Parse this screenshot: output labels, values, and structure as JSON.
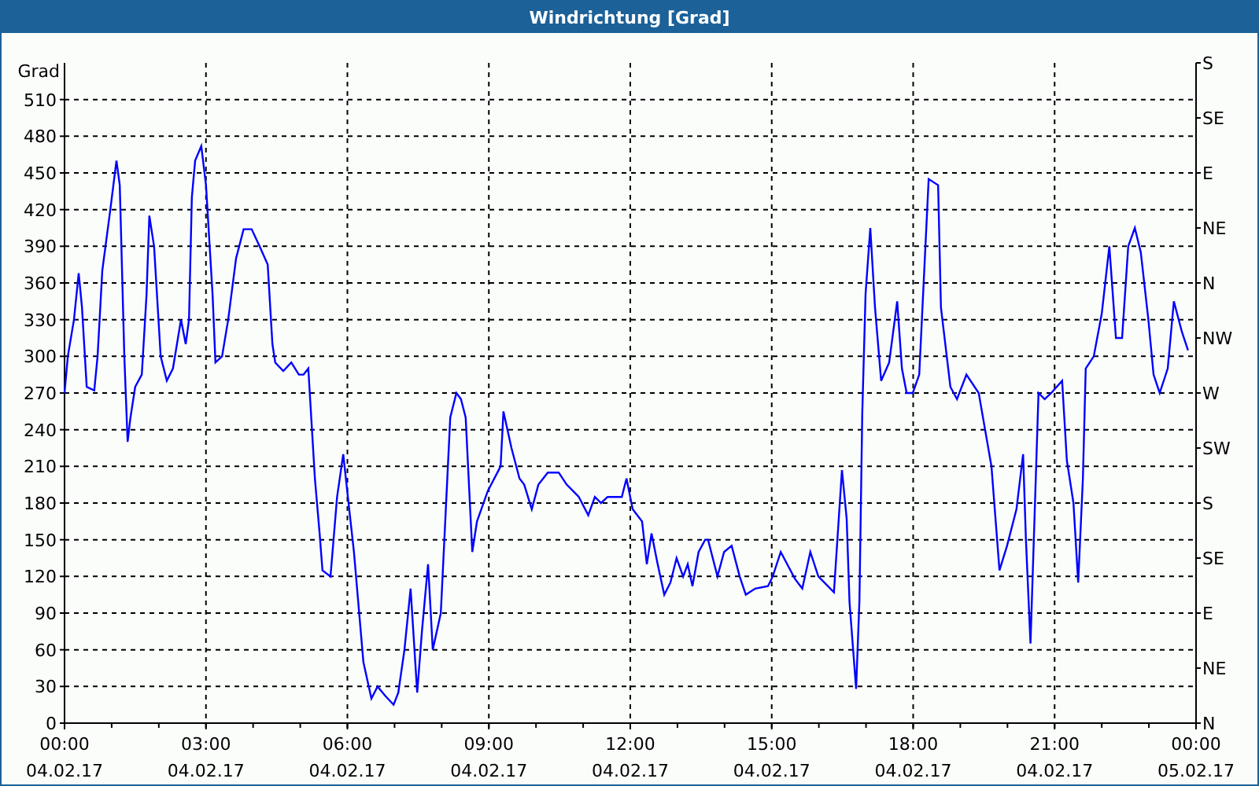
{
  "window": {
    "title": "Windrichtung [Grad]"
  },
  "chart": {
    "x_axis_dates": [
      "04.02.17",
      "04.02.17",
      "04.02.17",
      "04.02.17",
      "04.02.17",
      "04.02.17",
      "04.02.17",
      "04.02.17",
      "05.02.17"
    ],
    "right_axis": {
      "labels": [
        "S",
        "SE",
        "E",
        "NE",
        "N",
        "NW",
        "W",
        "SW",
        "S",
        "SE",
        "E",
        "NE",
        "N"
      ]
    },
    "chart_data": {
      "type": "line",
      "grid": true,
      "ylabel": "Grad",
      "xlim": [
        0,
        24
      ],
      "ylim": [
        0,
        540
      ],
      "xticks": [
        {
          "value": 0,
          "label": "00:00"
        },
        {
          "value": 3,
          "label": "03:00"
        },
        {
          "value": 6,
          "label": "06:00"
        },
        {
          "value": 9,
          "label": "09:00"
        },
        {
          "value": 12,
          "label": "12:00"
        },
        {
          "value": 15,
          "label": "15:00"
        },
        {
          "value": 18,
          "label": "18:00"
        },
        {
          "value": 21,
          "label": "21:00"
        },
        {
          "value": 24,
          "label": "00:00"
        }
      ],
      "yticks": [
        0,
        30,
        60,
        90,
        120,
        150,
        180,
        210,
        240,
        270,
        300,
        330,
        360,
        390,
        420,
        450,
        480,
        510
      ],
      "x": [
        0,
        0.07,
        0.2,
        0.3,
        0.37,
        0.47,
        0.63,
        0.7,
        0.8,
        0.97,
        1.1,
        1.17,
        1.27,
        1.34,
        1.4,
        1.5,
        1.64,
        1.74,
        1.8,
        1.9,
        2.04,
        2.17,
        2.3,
        2.47,
        2.57,
        2.64,
        2.7,
        2.77,
        2.9,
        3.0,
        3.14,
        3.2,
        3.34,
        3.47,
        3.64,
        3.8,
        3.97,
        4.14,
        4.31,
        4.41,
        4.47,
        4.64,
        4.81,
        4.97,
        5.07,
        5.17,
        5.31,
        5.41,
        5.47,
        5.64,
        5.78,
        5.91,
        6.04,
        6.14,
        6.34,
        6.51,
        6.64,
        6.81,
        6.98,
        7.08,
        7.21,
        7.34,
        7.48,
        7.58,
        7.71,
        7.81,
        7.98,
        8.08,
        8.18,
        8.31,
        8.41,
        8.51,
        8.65,
        8.75,
        8.98,
        9.25,
        9.31,
        9.48,
        9.65,
        9.75,
        9.91,
        10.05,
        10.25,
        10.48,
        10.65,
        10.78,
        10.91,
        11.11,
        11.25,
        11.38,
        11.52,
        11.65,
        11.82,
        11.92,
        12.05,
        12.25,
        12.35,
        12.45,
        12.58,
        12.72,
        12.85,
        12.98,
        13.12,
        13.22,
        13.32,
        13.45,
        13.59,
        13.65,
        13.85,
        13.99,
        14.15,
        14.32,
        14.45,
        14.65,
        14.92,
        15.02,
        15.19,
        15.49,
        15.65,
        15.82,
        15.99,
        16.32,
        16.49,
        16.59,
        16.65,
        16.79,
        16.86,
        16.92,
        16.99,
        17.09,
        17.19,
        17.32,
        17.49,
        17.66,
        17.76,
        17.86,
        17.99,
        18.13,
        18.33,
        18.53,
        18.59,
        18.79,
        18.93,
        19.13,
        19.39,
        19.66,
        19.83,
        19.99,
        20.19,
        20.33,
        20.39,
        20.49,
        20.66,
        20.79,
        20.93,
        21.16,
        21.26,
        21.4,
        21.5,
        21.6,
        21.66,
        21.83,
        22.0,
        22.16,
        22.3,
        22.43,
        22.56,
        22.7,
        22.83,
        22.99,
        23.1,
        23.23,
        23.4,
        23.53,
        23.7,
        23.83
      ],
      "series": [
        {
          "color": "#0000ff",
          "values": [
            270,
            300,
            330,
            368,
            340,
            275,
            272,
            300,
            370,
            420,
            460,
            440,
            300,
            230,
            250,
            275,
            285,
            350,
            415,
            390,
            300,
            280,
            290,
            330,
            310,
            330,
            430,
            460,
            472,
            440,
            350,
            295,
            300,
            330,
            380,
            404,
            404,
            390,
            375,
            310,
            295,
            288,
            295,
            285,
            285,
            290,
            200,
            155,
            125,
            120,
            185,
            220,
            175,
            140,
            50,
            20,
            30,
            22,
            15,
            25,
            60,
            110,
            25,
            75,
            130,
            60,
            90,
            170,
            250,
            270,
            265,
            250,
            140,
            165,
            190,
            210,
            255,
            225,
            200,
            195,
            175,
            195,
            205,
            205,
            195,
            190,
            185,
            170,
            185,
            180,
            185,
            185,
            185,
            200,
            175,
            165,
            130,
            155,
            130,
            105,
            115,
            135,
            120,
            130,
            112,
            140,
            150,
            150,
            120,
            140,
            145,
            120,
            105,
            110,
            112,
            120,
            140,
            118,
            110,
            140,
            120,
            107,
            207,
            167,
            99,
            28,
            100,
            253,
            351,
            405,
            340,
            280,
            295,
            345,
            290,
            270,
            270,
            285,
            445,
            440,
            340,
            275,
            265,
            285,
            270,
            210,
            125,
            145,
            175,
            220,
            150,
            65,
            270,
            265,
            270,
            280,
            215,
            180,
            115,
            200,
            290,
            300,
            335,
            390,
            315,
            315,
            390,
            405,
            385,
            330,
            285,
            270,
            290,
            345,
            320,
            305
          ]
        }
      ]
    }
  }
}
